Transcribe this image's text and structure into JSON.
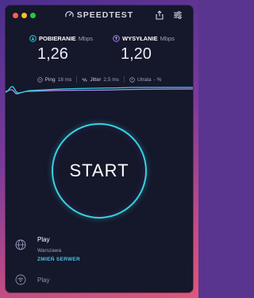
{
  "app": {
    "brand": "SPEEDTEST",
    "colors": {
      "accent_cyan": "#36d3e3",
      "accent_purple": "#b08cf6",
      "window_bg": "#15172a"
    }
  },
  "titlebar": {
    "icons": [
      "share-icon",
      "settings-sliders-icon"
    ]
  },
  "download": {
    "label": "POBIERANIE",
    "unit": "Mbps",
    "value": "1,26"
  },
  "upload": {
    "label": "WYSYŁANIE",
    "unit": "Mbps",
    "value": "1,20"
  },
  "stats": {
    "ping_label": "Ping",
    "ping_value": "18 ms",
    "jitter_label": "Jitter",
    "jitter_value": "2,5 ms",
    "loss_label": "Utrata",
    "loss_value": "- %"
  },
  "start": {
    "label": "START"
  },
  "server": {
    "name": "Play",
    "city": "Warszawa",
    "change_label": "ZMIEŃ SERWER"
  },
  "connection": {
    "name": "Play"
  }
}
